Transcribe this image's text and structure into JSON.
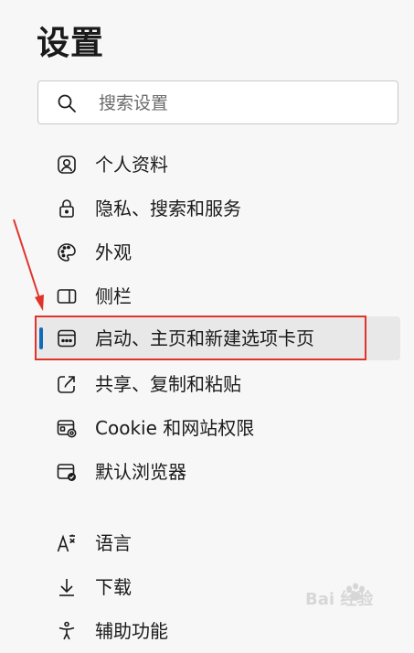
{
  "header": {
    "title": "设置"
  },
  "search": {
    "placeholder": "搜索设置"
  },
  "nav": {
    "items": [
      {
        "label": "个人资料",
        "icon": "profile-icon"
      },
      {
        "label": "隐私、搜索和服务",
        "icon": "lock-icon"
      },
      {
        "label": "外观",
        "icon": "palette-icon"
      },
      {
        "label": "侧栏",
        "icon": "sidebar-icon"
      },
      {
        "label": "启动、主页和新建选项卡页",
        "icon": "start-page-icon",
        "active": true
      },
      {
        "label": "共享、复制和粘贴",
        "icon": "share-icon"
      },
      {
        "label": "Cookie 和网站权限",
        "icon": "cookie-permissions-icon"
      },
      {
        "label": "默认浏览器",
        "icon": "default-browser-icon"
      },
      {
        "label": "语言",
        "icon": "language-icon"
      },
      {
        "label": "下载",
        "icon": "download-icon"
      },
      {
        "label": "辅助功能",
        "icon": "accessibility-icon"
      }
    ]
  },
  "colors": {
    "accent": "#0f6cbd",
    "annotation": "#e0342b",
    "active_bg": "#e8e8e8"
  },
  "watermark": {
    "text": "Bai 经验"
  }
}
